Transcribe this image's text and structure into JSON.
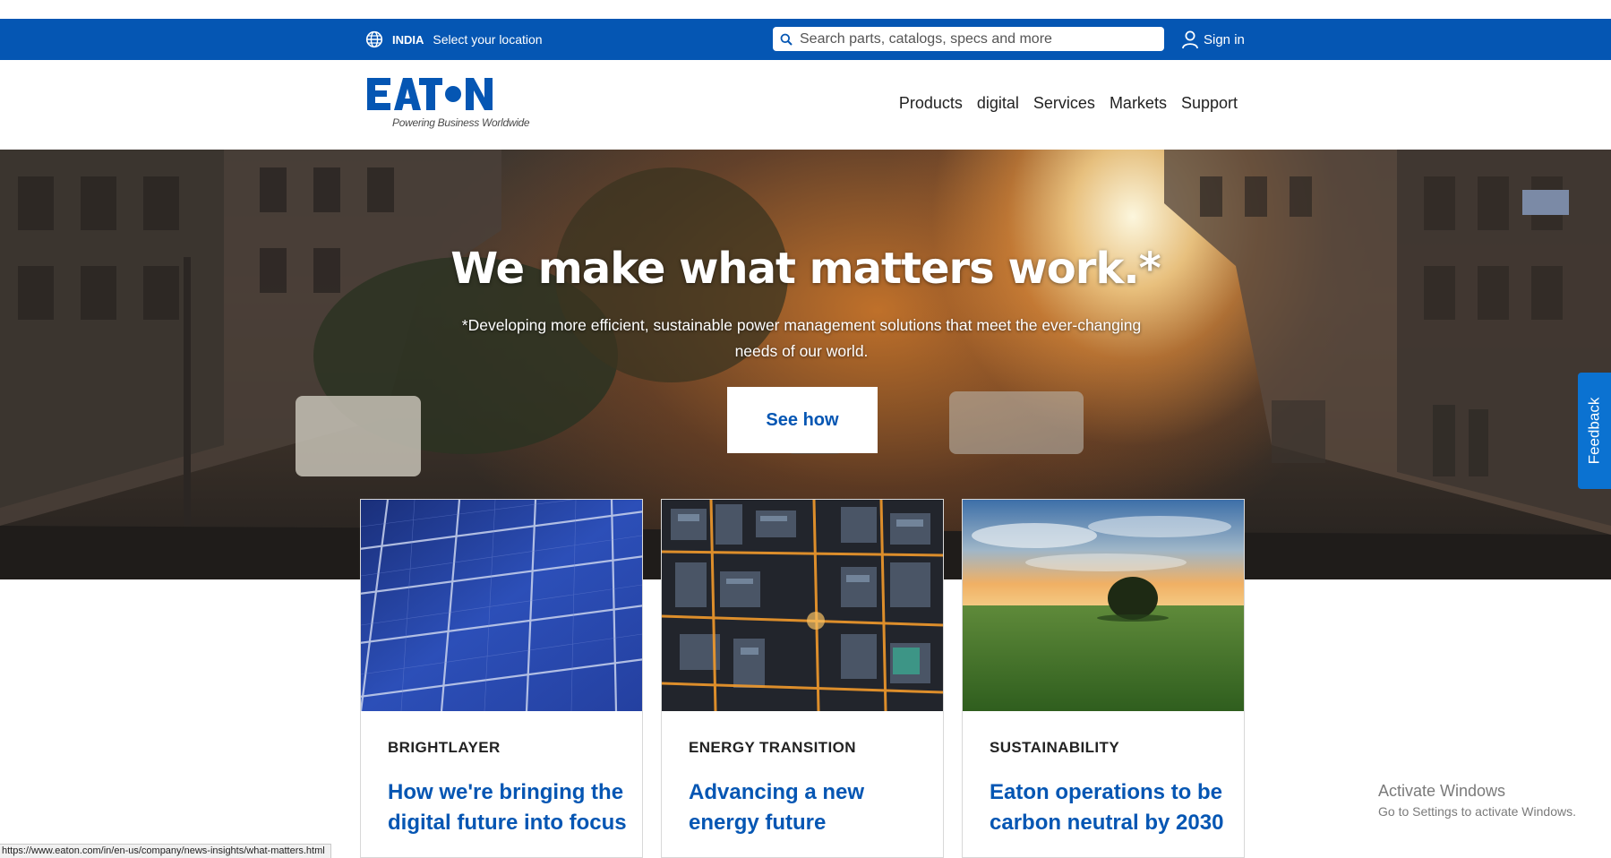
{
  "utility_bar": {
    "country": "INDIA",
    "location_label": "Select your location",
    "search_placeholder": "Search parts, catalogs, specs and more",
    "signin_label": "Sign in",
    "color": "#0556b3"
  },
  "header": {
    "logo_tagline": "Powering Business Worldwide",
    "nav": [
      "Products",
      "digital",
      "Services",
      "Markets",
      "Support"
    ]
  },
  "hero": {
    "title": "We make what matters work.*",
    "subtitle": "*Developing more efficient, sustainable power management solutions that meet the ever-changing needs of our world.",
    "cta": "See how"
  },
  "feedback_label": "Feedback",
  "cards": [
    {
      "category": "BRIGHTLAYER",
      "headline": "How we're bringing the digital future into focus",
      "image": "solar-panel-closeup"
    },
    {
      "category": "ENERGY TRANSITION",
      "headline": "Advancing a new energy future",
      "image": "aerial-city-night"
    },
    {
      "category": "SUSTAINABILITY",
      "headline": "Eaton operations to be carbon neutral by 2030",
      "image": "tree-field-sunset"
    }
  ],
  "activate_windows": {
    "title": "Activate Windows",
    "subtitle": "Go to Settings to activate Windows."
  },
  "status_url": "https://www.eaton.com/in/en-us/company/news-insights/what-matters.html"
}
